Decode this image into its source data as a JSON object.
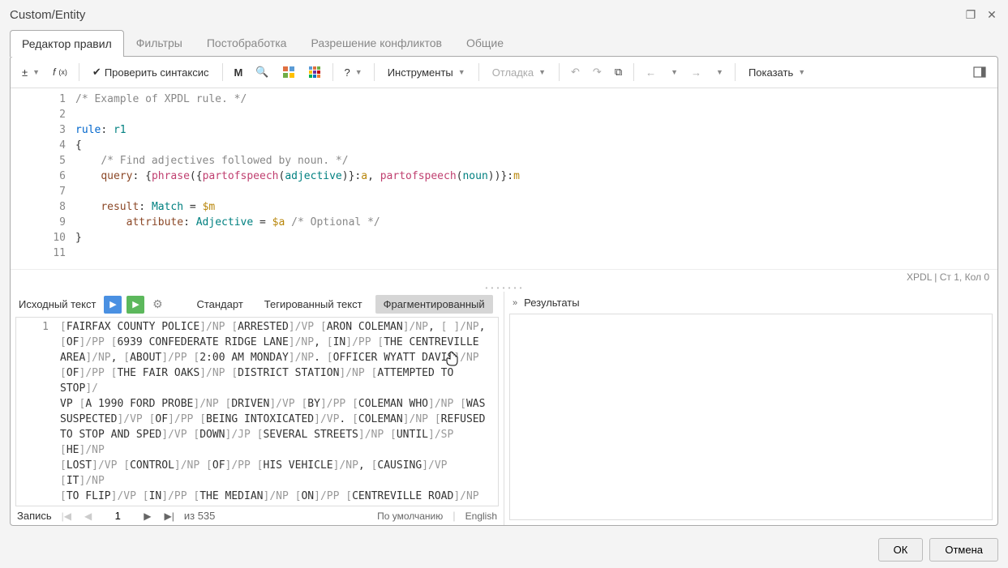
{
  "window": {
    "title": "Custom/Entity"
  },
  "main_tabs": [
    "Редактор правил",
    "Фильтры",
    "Постобработка",
    "Разрешение конфликтов",
    "Общие"
  ],
  "toolbar": {
    "check_syntax": "Проверить синтаксис",
    "tools": "Инструменты",
    "debug": "Отладка",
    "show": "Показать",
    "help": "?"
  },
  "code": {
    "lines": [
      {
        "n": 1,
        "tokens": [
          {
            "t": "/* Example of XPDL rule. */",
            "c": "cm"
          }
        ]
      },
      {
        "n": 2,
        "tokens": []
      },
      {
        "n": 3,
        "tokens": [
          {
            "t": "rule",
            "c": "kw"
          },
          {
            "t": ": "
          },
          {
            "t": "r1",
            "c": "str"
          }
        ]
      },
      {
        "n": 4,
        "tokens": [
          {
            "t": "{"
          }
        ]
      },
      {
        "n": 5,
        "tokens": [
          {
            "t": "    "
          },
          {
            "t": "/* Find adjectives followed by noun. */",
            "c": "cm"
          }
        ]
      },
      {
        "n": 6,
        "tokens": [
          {
            "t": "    "
          },
          {
            "t": "query",
            "c": "prop"
          },
          {
            "t": ": {"
          },
          {
            "t": "phrase",
            "c": "fn"
          },
          {
            "t": "({"
          },
          {
            "t": "partofspeech",
            "c": "fn"
          },
          {
            "t": "("
          },
          {
            "t": "adjective",
            "c": "str"
          },
          {
            "t": ")}:"
          },
          {
            "t": "a",
            "c": "var"
          },
          {
            "t": ", "
          },
          {
            "t": "partofspeech",
            "c": "fn"
          },
          {
            "t": "("
          },
          {
            "t": "noun",
            "c": "str"
          },
          {
            "t": "))}:"
          },
          {
            "t": "m",
            "c": "var"
          }
        ]
      },
      {
        "n": 7,
        "tokens": []
      },
      {
        "n": 8,
        "tokens": [
          {
            "t": "    "
          },
          {
            "t": "result",
            "c": "prop"
          },
          {
            "t": ": "
          },
          {
            "t": "Match",
            "c": "str"
          },
          {
            "t": " = "
          },
          {
            "t": "$m",
            "c": "var"
          }
        ]
      },
      {
        "n": 9,
        "tokens": [
          {
            "t": "        "
          },
          {
            "t": "attribute",
            "c": "prop"
          },
          {
            "t": ": "
          },
          {
            "t": "Adjective",
            "c": "str"
          },
          {
            "t": " = "
          },
          {
            "t": "$a",
            "c": "var"
          },
          {
            "t": " "
          },
          {
            "t": "/* Optional */",
            "c": "cm"
          }
        ]
      },
      {
        "n": 10,
        "tokens": [
          {
            "t": "}"
          }
        ]
      },
      {
        "n": 11,
        "tokens": []
      }
    ]
  },
  "status": {
    "lang": "XPDL",
    "pos": "Ст 1, Кол 0"
  },
  "lower": {
    "source_label": "Исходный текст",
    "view_tabs": [
      "Стандарт",
      "Тегированный текст",
      "Фрагментированный"
    ],
    "results_label": "Результаты",
    "text_lines": [
      "[FAIRFAX COUNTY POLICE]/NP [ARRESTED]/VP [ARON COLEMAN]/NP, [  ]/NP,",
      "[OF]/PP [6939 CONFEDERATE RIDGE LANE]/NP, [IN]/PP [THE CENTREVILLE",
      "AREA]/NP, [ABOUT]/PP [2:00 AM MONDAY]/NP.  [OFFICER WYATT DAVIS]/NP",
      "[OF]/PP [THE FAIR OAKS]/NP [DISTRICT STATION]/NP [ATTEMPTED TO STOP]/",
      "VP [A 1990 FORD PROBE]/NP [DRIVEN]/VP [BY]/PP [COLEMAN WHO]/NP [WAS",
      "SUSPECTED]/VP [OF]/PP [BEING INTOXICATED]/VP.  [COLEMAN]/NP [REFUSED",
      "TO STOP AND SPED]/VP [DOWN]/JP [SEVERAL STREETS]/NP [UNTIL]/SP [HE]/NP",
      "[LOST]/VP [CONTROL]/NP [OF]/PP [HIS VEHICLE]/NP, [CAUSING]/VP [IT]/NP",
      "[TO FLIP]/VP [IN]/PP [THE MEDIAN]/NP [ON]/PP [CENTREVILLE ROAD]/NP"
    ],
    "nav": {
      "record_label": "Запись",
      "current": "1",
      "total_prefix": "из",
      "total": "535",
      "default_label": "По умолчанию",
      "language": "English"
    }
  },
  "footer": {
    "ok": "ОК",
    "cancel": "Отмена"
  }
}
